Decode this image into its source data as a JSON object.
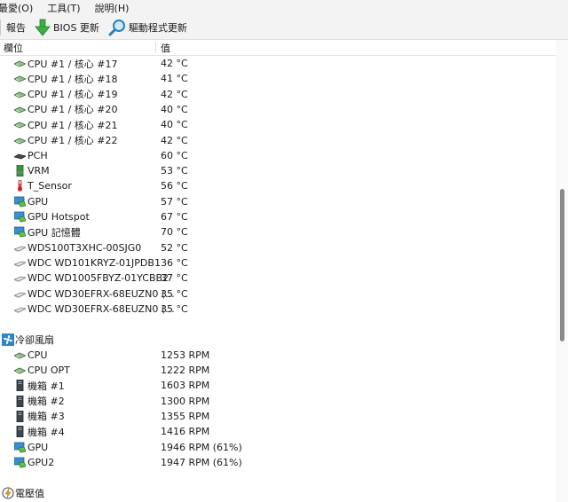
{
  "menu": [
    "最愛(O)",
    "工具(T)",
    "說明(H)"
  ],
  "toolbar": {
    "report": "報告",
    "bios": "BIOS 更新",
    "driver": "驅動程式更新"
  },
  "columns": {
    "field": "欄位",
    "value": "值"
  },
  "rows": [
    {
      "name": "CPU #1 / 核心 #17",
      "value": "42 °C",
      "icon": "cpu-chip-icon"
    },
    {
      "name": "CPU #1 / 核心 #18",
      "value": "41 °C",
      "icon": "cpu-chip-icon"
    },
    {
      "name": "CPU #1 / 核心 #19",
      "value": "42 °C",
      "icon": "cpu-chip-icon"
    },
    {
      "name": "CPU #1 / 核心 #20",
      "value": "40 °C",
      "icon": "cpu-chip-icon"
    },
    {
      "name": "CPU #1 / 核心 #21",
      "value": "40 °C",
      "icon": "cpu-chip-icon"
    },
    {
      "name": "CPU #1 / 核心 #22",
      "value": "42 °C",
      "icon": "cpu-chip-icon"
    },
    {
      "name": "PCH",
      "value": "60 °C",
      "icon": "chipset-icon"
    },
    {
      "name": "VRM",
      "value": "53 °C",
      "icon": "vrm-icon"
    },
    {
      "name": "T_Sensor",
      "value": "56 °C",
      "icon": "thermometer-icon"
    },
    {
      "name": "GPU",
      "value": "57 °C",
      "icon": "gpu-icon"
    },
    {
      "name": "GPU Hotspot",
      "value": "67 °C",
      "icon": "gpu-icon"
    },
    {
      "name": "GPU 記憶體",
      "value": "70 °C",
      "icon": "gpu-icon"
    },
    {
      "name": "WDS100T3XHC-00SJG0",
      "value": "52 °C",
      "icon": "drive-icon"
    },
    {
      "name": "WDC WD101KRYZ-01JPDB1",
      "value": "36 °C",
      "icon": "drive-icon"
    },
    {
      "name": "WDC WD1005FBYZ-01YCBB2",
      "value": "37 °C",
      "icon": "drive-icon"
    },
    {
      "name": "WDC WD30EFRX-68EUZN0 (...",
      "value": "35 °C",
      "icon": "drive-icon"
    },
    {
      "name": "WDC WD30EFRX-68EUZN0 (...",
      "value": "35 °C",
      "icon": "drive-icon"
    }
  ],
  "fans_group": {
    "label": "冷卻風扇",
    "icon": "fan-icon"
  },
  "fans": [
    {
      "name": "CPU",
      "value": "1253 RPM",
      "icon": "cpu-chip-icon"
    },
    {
      "name": "CPU OPT",
      "value": "1222 RPM",
      "icon": "cpu-chip-icon"
    },
    {
      "name": "機箱 #1",
      "value": "1603 RPM",
      "icon": "case-icon"
    },
    {
      "name": "機箱 #2",
      "value": "1300 RPM",
      "icon": "case-icon"
    },
    {
      "name": "機箱 #3",
      "value": "1355 RPM",
      "icon": "case-icon"
    },
    {
      "name": "機箱 #4",
      "value": "1416 RPM",
      "icon": "case-icon"
    },
    {
      "name": "GPU",
      "value": "1946 RPM  (61%)",
      "icon": "gpu-icon"
    },
    {
      "name": "GPU2",
      "value": "1947 RPM  (61%)",
      "icon": "gpu-icon"
    }
  ],
  "voltage_group": {
    "label": "電壓值",
    "icon": "voltage-icon"
  }
}
